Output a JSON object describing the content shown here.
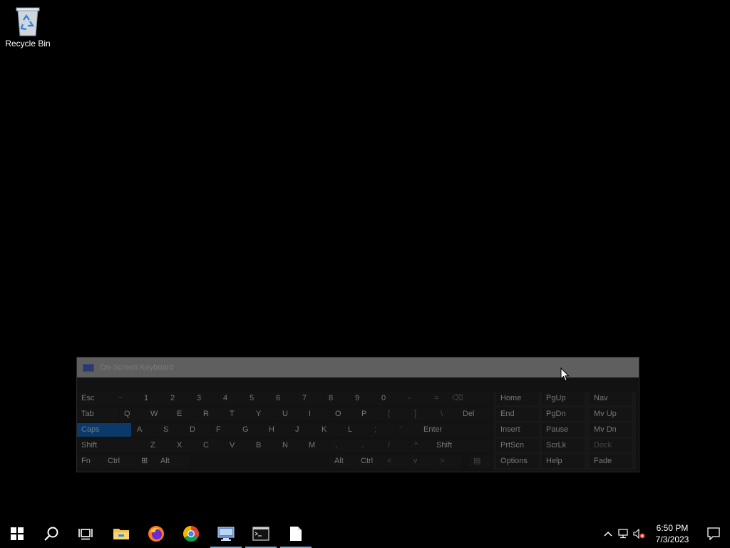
{
  "desktop": {
    "icons": [
      {
        "label": "Recycle Bin",
        "icon": "recycle-bin-icon"
      }
    ]
  },
  "osk": {
    "title": "On-Screen Keyboard",
    "rows": [
      [
        "Esc",
        "~",
        "1",
        "2",
        "3",
        "4",
        "5",
        "6",
        "7",
        "8",
        "9",
        "0",
        "-",
        "=",
        "⌫"
      ],
      [
        "Tab",
        "Q",
        "W",
        "E",
        "R",
        "T",
        "Y",
        "U",
        "I",
        "O",
        "P",
        "[",
        "]",
        "\\",
        "Del"
      ],
      [
        "Caps",
        "A",
        "S",
        "D",
        "F",
        "G",
        "H",
        "J",
        "K",
        "L",
        ";",
        "'",
        "Enter"
      ],
      [
        "Shift",
        "Z",
        "X",
        "C",
        "V",
        "B",
        "N",
        "M",
        ",",
        ".",
        "/",
        "^",
        "Shift"
      ],
      [
        "Fn",
        "Ctrl",
        "⊞",
        "Alt",
        "Alt",
        "Ctrl",
        "<",
        "v",
        ">",
        "▤"
      ]
    ],
    "nav_rows": [
      [
        "Home",
        "PgUp",
        "Nav"
      ],
      [
        "End",
        "PgDn",
        "Mv Up"
      ],
      [
        "Insert",
        "Pause",
        "Mv Dn"
      ],
      [
        "PrtScn",
        "ScrLk",
        "Dock"
      ],
      [
        "Options",
        "Help",
        "Fade"
      ]
    ]
  },
  "taskbar": {
    "items": [
      {
        "name": "start-button",
        "icon": "windows-logo-icon"
      },
      {
        "name": "search-button",
        "icon": "search-icon"
      },
      {
        "name": "task-view-button",
        "icon": "task-view-icon"
      },
      {
        "name": "file-explorer-button",
        "icon": "folder-icon"
      },
      {
        "name": "firefox-button",
        "icon": "firefox-icon"
      },
      {
        "name": "chrome-button",
        "icon": "chrome-icon"
      },
      {
        "name": "remote-desktop-button",
        "icon": "remote-desktop-icon"
      },
      {
        "name": "terminal-button",
        "icon": "terminal-icon"
      },
      {
        "name": "notepad-button",
        "icon": "document-icon"
      }
    ],
    "clock": {
      "time": "6:50 PM",
      "date": "7/3/2023"
    }
  },
  "colors": {
    "desktop": "#000000",
    "accent": "#7aa7d6",
    "caps_active": "#0b3a6a",
    "titlebar": "#5f5f5f"
  }
}
